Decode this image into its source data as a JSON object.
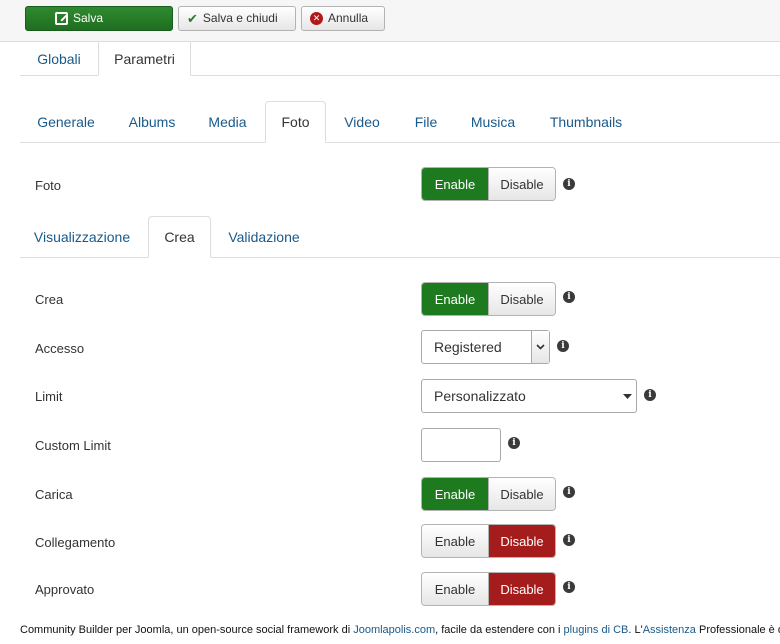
{
  "toolbar": {
    "save_label": "Salva",
    "save_close_label": "Salva e chiudi",
    "cancel_label": "Annulla"
  },
  "main_tabs": [
    "Globali",
    "Parametri"
  ],
  "section_tabs": [
    "Generale",
    "Albums",
    "Media",
    "Foto",
    "Video",
    "File",
    "Musica",
    "Thumbnails"
  ],
  "sub_tabs": [
    "Visualizzazione",
    "Crea",
    "Validazione"
  ],
  "toggle_labels": {
    "enable": "Enable",
    "disable": "Disable"
  },
  "fields": {
    "foto": {
      "label": "Foto",
      "value": "Enable"
    },
    "crea": {
      "label": "Crea",
      "value": "Enable"
    },
    "accesso": {
      "label": "Accesso",
      "value": "Registered"
    },
    "limit": {
      "label": "Limit",
      "value": "Personalizzato"
    },
    "custom_limit": {
      "label": "Custom Limit",
      "value": ""
    },
    "carica": {
      "label": "Carica",
      "value": "Enable"
    },
    "collegamento": {
      "label": "Collegamento",
      "value": "Disable"
    },
    "approvato": {
      "label": "Approvato",
      "value": "Disable"
    }
  },
  "footer": {
    "text1": "Community Builder per Joomla, un open-source social framework di ",
    "link1": "Joomlapolis.com",
    "text2": ", facile da estendere con i ",
    "link2": "plugins di CB",
    "text3": ". L'",
    "link3": "Assistenza",
    "text4": " Professionale è dis"
  },
  "colors": {
    "enable_active": "#1e7a1e",
    "disable_active": "#a51c1c",
    "link": "#1a5a8a"
  }
}
